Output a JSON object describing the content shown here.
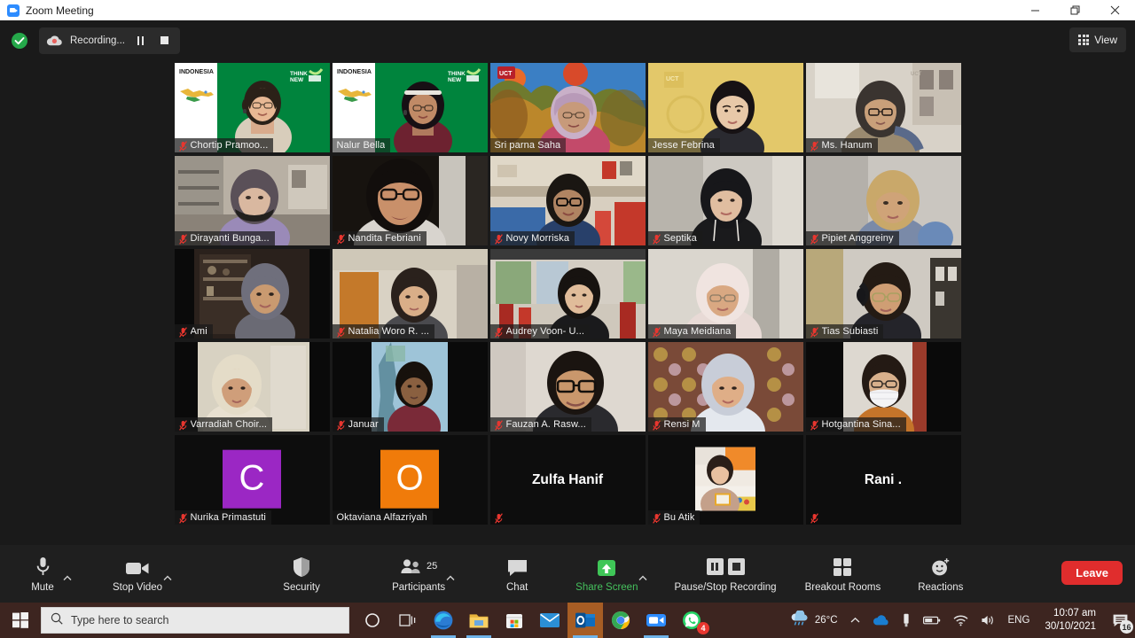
{
  "window": {
    "title": "Zoom Meeting",
    "icon": "zoom-icon",
    "minimize": "minimize-icon",
    "restore": "restore-icon",
    "close": "close-icon"
  },
  "topbar": {
    "encryption_icon": "shield-check-icon",
    "recording_icon": "recording-cloud-icon",
    "recording_label": "Recording...",
    "pause_recording_icon": "pause-icon",
    "stop_recording_icon": "stop-icon",
    "view_label": "View",
    "view_icon": "grid-icon"
  },
  "gallery": {
    "rows": [
      [
        {
          "name": "Chortip Pramoo...",
          "muted": true,
          "active": false,
          "bg": "indonesia-green",
          "type": "video"
        },
        {
          "name": "Nalur  Bella",
          "muted": false,
          "active": true,
          "bg": "indonesia-green",
          "type": "video"
        },
        {
          "name": "Sri parna Saha",
          "muted": false,
          "active": false,
          "bg": "autumn-trees",
          "type": "video"
        },
        {
          "name": "Jesse Febrina",
          "muted": false,
          "active": false,
          "bg": "gold-uct",
          "type": "video"
        },
        {
          "name": "Ms. Hanum",
          "muted": true,
          "active": false,
          "bg": "room-wall",
          "type": "video"
        }
      ],
      [
        {
          "name": "Dirayanti Bunga...",
          "muted": true,
          "active": false,
          "bg": "shop-interior",
          "type": "video"
        },
        {
          "name": "Nandita Febriani",
          "muted": true,
          "active": false,
          "bg": "dark-closeup",
          "type": "video"
        },
        {
          "name": "Novy Morriska",
          "muted": true,
          "active": false,
          "bg": "cafe-interior",
          "type": "video"
        },
        {
          "name": "Septika",
          "muted": true,
          "active": false,
          "bg": "plain-wall",
          "type": "video"
        },
        {
          "name": "Pipiet Anggreiny",
          "muted": true,
          "active": false,
          "bg": "plain-grey",
          "type": "video"
        }
      ],
      [
        {
          "name": "Ami",
          "muted": true,
          "active": false,
          "bg": "bookshelf",
          "type": "video"
        },
        {
          "name": "Natalia Woro R. ...",
          "muted": true,
          "active": false,
          "bg": "warm-wall",
          "type": "video"
        },
        {
          "name": "Audrey Voon- U...",
          "muted": true,
          "active": false,
          "bg": "red-window",
          "type": "video"
        },
        {
          "name": "Maya Meidiana",
          "muted": true,
          "active": false,
          "bg": "light-wall",
          "type": "video"
        },
        {
          "name": "Tias Subiasti",
          "muted": true,
          "active": false,
          "bg": "shelf-wall",
          "type": "video"
        }
      ],
      [
        {
          "name": "Varradiah Choir...",
          "muted": true,
          "active": false,
          "bg": "car-interior",
          "type": "video"
        },
        {
          "name": "Januar",
          "muted": true,
          "active": false,
          "bg": "blue-curtain",
          "type": "video"
        },
        {
          "name": "Fauzan A. Rasw...",
          "muted": true,
          "active": false,
          "bg": "white-wall",
          "type": "video"
        },
        {
          "name": "Rensi M",
          "muted": true,
          "active": false,
          "bg": "batik-wall",
          "type": "video"
        },
        {
          "name": "Hotgantina Sina...",
          "muted": true,
          "active": false,
          "bg": "mask-wall",
          "type": "video"
        }
      ],
      [
        {
          "name": "Nurika Primastuti",
          "muted": true,
          "active": false,
          "type": "initial",
          "initial": "C",
          "avatar_color": "#9b27c4"
        },
        {
          "name": "Oktaviana Alfazriyah",
          "muted": false,
          "active": false,
          "type": "initial",
          "initial": "O",
          "avatar_color": "#f07b0a"
        },
        {
          "name": "Zulfa Hanif",
          "muted": true,
          "active": false,
          "type": "bigname"
        },
        {
          "name": "Bu Atik",
          "muted": true,
          "active": false,
          "type": "photo"
        },
        {
          "name": "Rani .",
          "muted": true,
          "active": false,
          "type": "bigname"
        }
      ]
    ],
    "virtual_bg_text": {
      "country": "INDONESIA",
      "slogan_line1": "THINK",
      "slogan_line2": "NEW"
    }
  },
  "toolbar": {
    "mute": {
      "label": "Mute",
      "icon": "microphone-icon",
      "has_caret": true
    },
    "video": {
      "label": "Stop Video",
      "icon": "camera-icon",
      "has_caret": true
    },
    "security": {
      "label": "Security",
      "icon": "shield-icon"
    },
    "participants": {
      "label": "Participants",
      "icon": "people-icon",
      "count": "25",
      "has_caret": true
    },
    "chat": {
      "label": "Chat",
      "icon": "chat-bubble-icon"
    },
    "share": {
      "label": "Share Screen",
      "icon": "share-up-arrow-icon",
      "color": "#45c15d",
      "has_caret": true
    },
    "recording": {
      "label": "Pause/Stop Recording",
      "pause_icon": "pause-icon",
      "stop_icon": "stop-icon"
    },
    "breakout": {
      "label": "Breakout Rooms",
      "icon": "breakout-grid-icon"
    },
    "reactions": {
      "label": "Reactions",
      "icon": "smiley-plus-icon"
    },
    "leave": {
      "label": "Leave",
      "color": "#e02d2d"
    }
  },
  "taskbar": {
    "start_icon": "windows-logo-icon",
    "search_placeholder": "Type here to search",
    "search_icon": "search-icon",
    "apps": [
      {
        "name": "cortana-icon"
      },
      {
        "name": "task-view-icon"
      },
      {
        "name": "edge-icon"
      },
      {
        "name": "file-explorer-icon"
      },
      {
        "name": "microsoft-store-icon"
      },
      {
        "name": "mail-icon"
      },
      {
        "name": "outlook-icon"
      },
      {
        "name": "chrome-icon"
      },
      {
        "name": "zoom-icon"
      },
      {
        "name": "whatsapp-icon",
        "badge": "4"
      }
    ],
    "weather": {
      "icon": "rain-cloud-icon",
      "temperature": "26°C"
    },
    "tray": {
      "show_hidden_icon": "chevron-up-icon",
      "onedrive_icon": "onedrive-icon",
      "usb_icon": "usb-icon",
      "battery_icon": "battery-icon",
      "network_icon": "wifi-icon",
      "volume_icon": "speaker-icon",
      "language": "ENG"
    },
    "clock": {
      "time": "10:07 am",
      "date": "30/10/2021"
    },
    "notifications": {
      "icon": "notification-icon",
      "badge": "16"
    }
  }
}
